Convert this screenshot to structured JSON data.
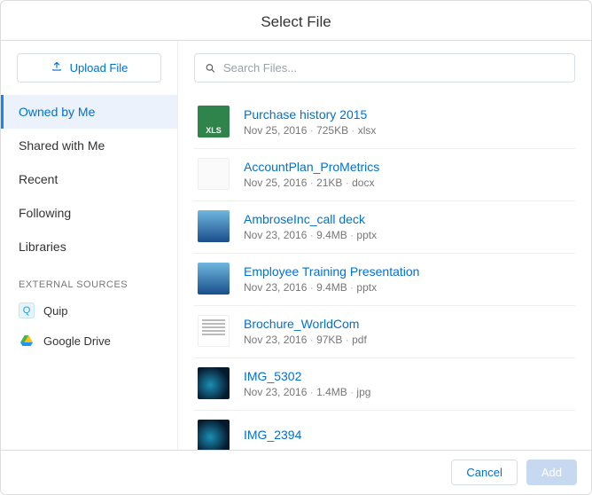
{
  "header": {
    "title": "Select File"
  },
  "sidebar": {
    "upload_label": "Upload File",
    "items": [
      {
        "label": "Owned by Me",
        "active": true
      },
      {
        "label": "Shared with Me"
      },
      {
        "label": "Recent"
      },
      {
        "label": "Following"
      },
      {
        "label": "Libraries"
      }
    ],
    "external_label": "EXTERNAL SOURCES",
    "external": [
      {
        "label": "Quip",
        "icon": "quip"
      },
      {
        "label": "Google Drive",
        "icon": "gdrive"
      }
    ]
  },
  "search": {
    "placeholder": "Search Files..."
  },
  "files": [
    {
      "name": "Purchase history 2015",
      "date": "Nov 25, 2016",
      "size": "725KB",
      "ext": "xlsx",
      "thumb": "xls",
      "thumb_text": "XLS"
    },
    {
      "name": "AccountPlan_ProMetrics",
      "date": "Nov 25, 2016",
      "size": "21KB",
      "ext": "docx",
      "thumb": "blank"
    },
    {
      "name": "AmbroseInc_call deck",
      "date": "Nov 23, 2016",
      "size": "9.4MB",
      "ext": "pptx",
      "thumb": "ppt"
    },
    {
      "name": "Employee Training Presentation",
      "date": "Nov 23, 2016",
      "size": "9.4MB",
      "ext": "pptx",
      "thumb": "ppt"
    },
    {
      "name": "Brochure_WorldCom",
      "date": "Nov 23, 2016",
      "size": "97KB",
      "ext": "pdf",
      "thumb": "pdf"
    },
    {
      "name": "IMG_5302",
      "date": "Nov 23, 2016",
      "size": "1.4MB",
      "ext": "jpg",
      "thumb": "jpg"
    },
    {
      "name": "IMG_2394",
      "date": "",
      "size": "",
      "ext": "",
      "thumb": "jpg"
    }
  ],
  "footer": {
    "cancel": "Cancel",
    "add": "Add"
  }
}
